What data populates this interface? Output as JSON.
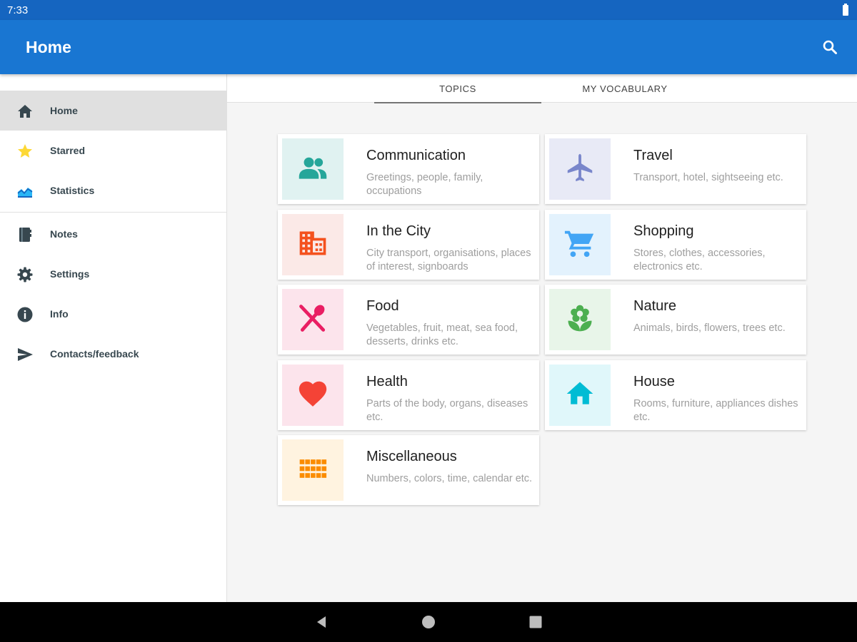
{
  "status_bar": {
    "time": "7:33"
  },
  "app_bar": {
    "title": "Home",
    "search_icon": "search-icon"
  },
  "drawer": {
    "items": [
      {
        "label": "Home",
        "icon": "home-icon",
        "active": true
      },
      {
        "label": "Starred",
        "icon": "star-icon"
      },
      {
        "label": "Statistics",
        "icon": "chart-icon"
      },
      {
        "label": "Notes",
        "icon": "notebook-icon"
      },
      {
        "label": "Settings",
        "icon": "gear-icon"
      },
      {
        "label": "Info",
        "icon": "info-icon"
      },
      {
        "label": "Contacts/feedback",
        "icon": "send-icon"
      }
    ]
  },
  "tabs": [
    {
      "label": "TOPICS",
      "active": true
    },
    {
      "label": "MY VOCABULARY",
      "active": false
    }
  ],
  "topics": [
    {
      "title": "Communication",
      "description": "Greetings, people, family, occupations",
      "icon": "people-icon",
      "tile_color": "#e0f2f1",
      "icon_color": "#26a69a"
    },
    {
      "title": "Travel",
      "description": "Transport, hotel, sightseeing etc.",
      "icon": "airplane-icon",
      "tile_color": "#e8eaf6",
      "icon_color": "#7986cb"
    },
    {
      "title": "In the City",
      "description": "City transport, organisations, places of interest, signboards",
      "icon": "building-icon",
      "tile_color": "#fbe9e7",
      "icon_color": "#f4511e"
    },
    {
      "title": "Shopping",
      "description": "Stores, clothes, accessories, electronics etc.",
      "icon": "cart-icon",
      "tile_color": "#e3f2fd",
      "icon_color": "#42a5f5"
    },
    {
      "title": "Food",
      "description": "Vegetables, fruit, meat, sea food, desserts, drinks etc.",
      "icon": "utensils-icon",
      "tile_color": "#fce4ec",
      "icon_color": "#e91e63"
    },
    {
      "title": "Nature",
      "description": "Animals, birds, flowers, trees etc.",
      "icon": "flower-icon",
      "tile_color": "#e8f5e9",
      "icon_color": "#4caf50"
    },
    {
      "title": "Health",
      "description": "Parts of the body, organs, diseases etc.",
      "icon": "heart-icon",
      "tile_color": "#fce4ec",
      "icon_color": "#f44336"
    },
    {
      "title": "House",
      "description": "Rooms, furniture, appliances dishes etc.",
      "icon": "house-icon",
      "tile_color": "#e0f7fa",
      "icon_color": "#00bcd4"
    },
    {
      "title": "Miscellaneous",
      "description": "Numbers, colors, time, calendar etc.",
      "icon": "grid-icon",
      "tile_color": "#fff3e0",
      "icon_color": "#fb8c00"
    }
  ],
  "nav_bar": {
    "back": "back-icon",
    "home": "home-circle-icon",
    "recents": "recents-icon"
  },
  "colors": {
    "status_bar": "#1565c0",
    "app_bar": "#1976d2"
  }
}
